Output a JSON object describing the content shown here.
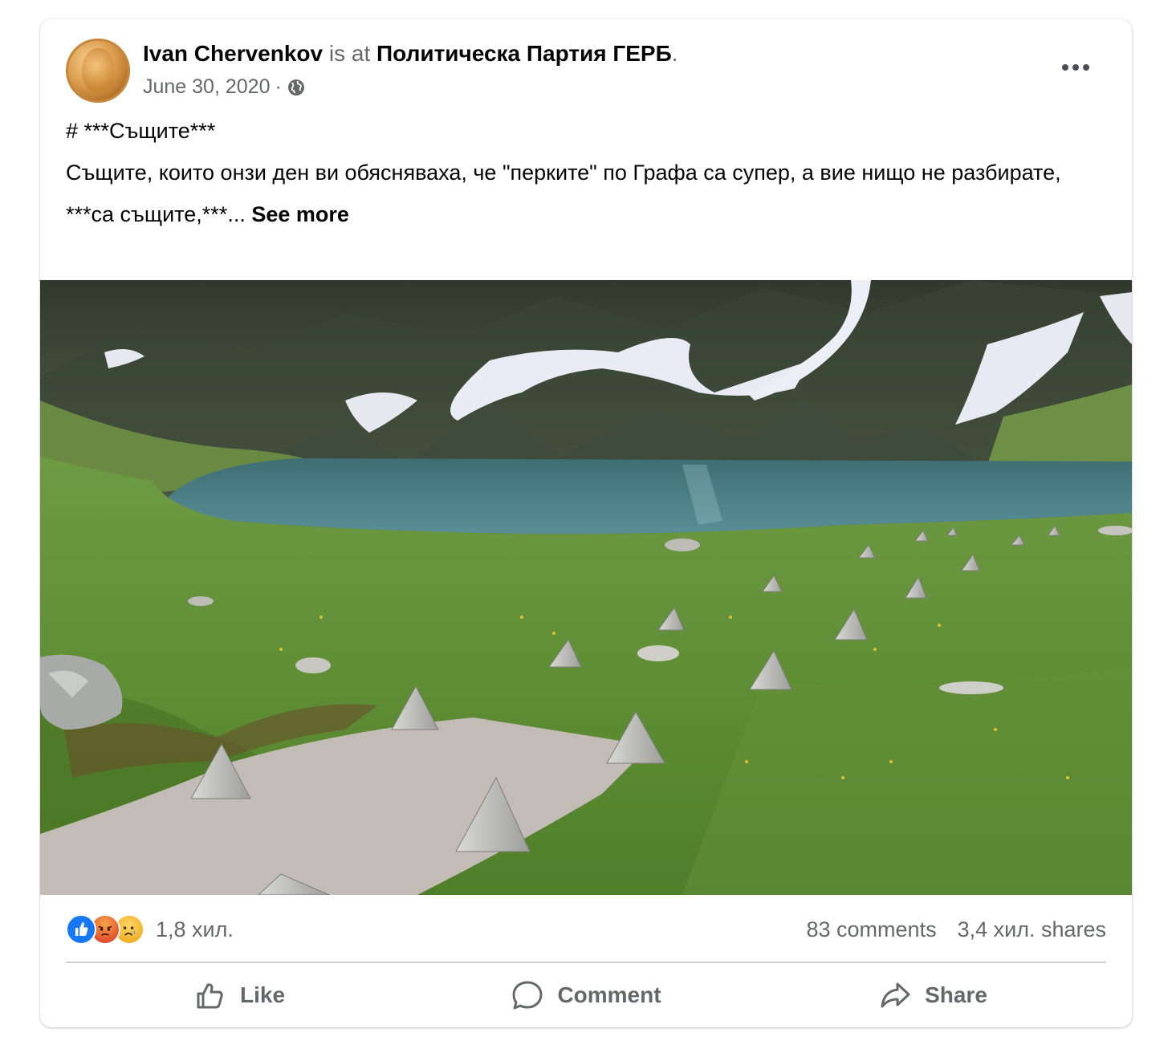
{
  "post": {
    "author": "Ivan Chervenkov",
    "is_at": "is at",
    "place": "Политическа Партия ГЕРБ",
    "place_suffix": ".",
    "date": "June 30, 2020",
    "date_separator": "·",
    "privacy_icon": "globe-icon",
    "more_icon": "more-options-icon",
    "text": {
      "line1": "# ***Същите***",
      "line2": "Същите, които онзи ден ви обясняваха, че \"перките\" по Графа са супер, а вие нищо не разбирате,",
      "line3": "***са същите,***...",
      "see_more": "See more"
    }
  },
  "reactions": {
    "icons": [
      "like-reaction-icon",
      "angry-reaction-icon",
      "sad-reaction-icon"
    ],
    "count": "1,8 хил.",
    "comments": "83 comments",
    "shares": "3,4 хил. shares"
  },
  "actions": {
    "like": "Like",
    "comment": "Comment",
    "share": "Share"
  },
  "colors": {
    "like_blue": "#1877f2",
    "angry_red": "#e9710f",
    "sad_yellow": "#f7b125",
    "secondary_text": "#65676b"
  }
}
